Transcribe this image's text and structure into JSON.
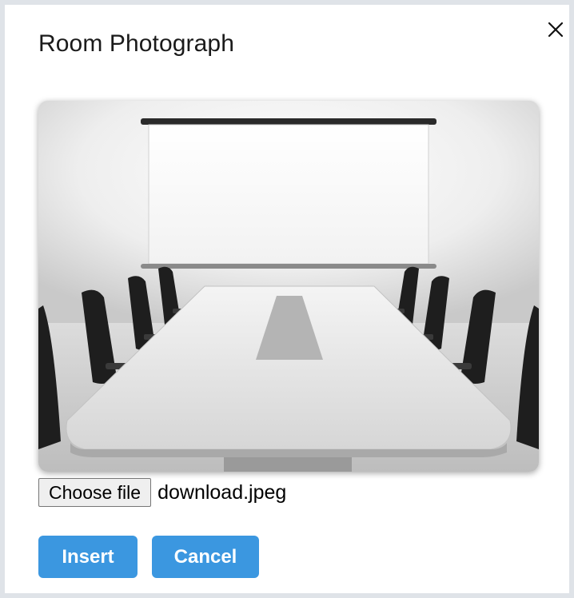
{
  "dialog": {
    "title": "Room Photograph",
    "close_icon": "close-icon"
  },
  "image": {
    "alt": "Conference room with long white table, black office chairs and a projector screen"
  },
  "file_input": {
    "button_label": "Choose file",
    "file_name": "download.jpeg"
  },
  "actions": {
    "insert_label": "Insert",
    "cancel_label": "Cancel"
  },
  "colors": {
    "primary_button": "#3b97e0",
    "button_text": "#ffffff"
  }
}
